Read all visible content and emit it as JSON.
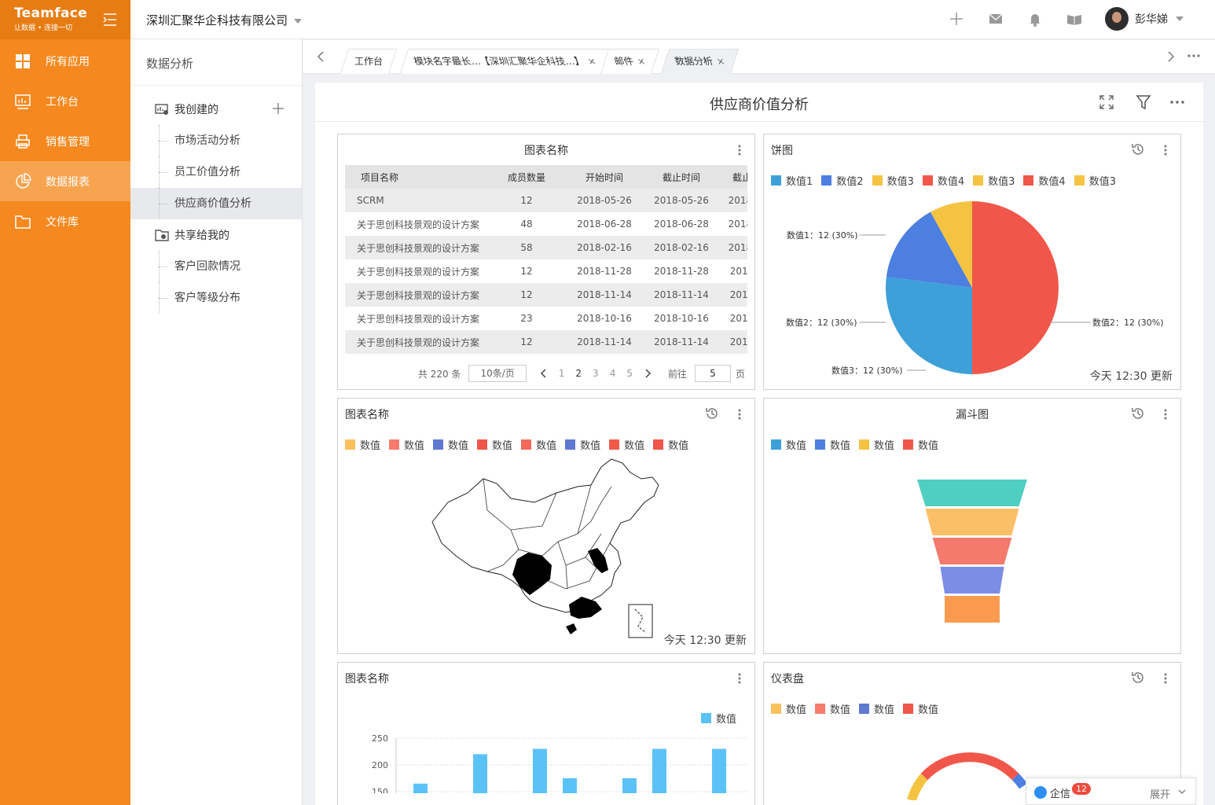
{
  "brand": {
    "name": "Teamface",
    "slogan": "让数据 • 连接一切"
  },
  "nav": [
    {
      "label": "所有应用",
      "icon": "grid-icon"
    },
    {
      "label": "工作台",
      "icon": "dashboard-icon"
    },
    {
      "label": "销售管理",
      "icon": "printer-icon"
    },
    {
      "label": "数据报表",
      "icon": "pie-chart-icon",
      "active": true
    },
    {
      "label": "文件库",
      "icon": "folder-icon"
    }
  ],
  "header": {
    "company": "深圳汇聚华企科技有限公司",
    "user": "彭华娣"
  },
  "tree": {
    "title": "数据分析",
    "mine": "我创建的",
    "mine_items": [
      "市场活动分析",
      "员工价值分析",
      "供应商价值分析"
    ],
    "shared": "共享给我的",
    "shared_items": [
      "客户回款情况",
      "客户等级分布"
    ]
  },
  "tabs": [
    "工作台",
    "模块名字最长…【深圳汇聚华企科技…】",
    "邮件",
    "数据分析"
  ],
  "page": {
    "title": "供应商价值分析"
  },
  "table_card": {
    "title": "图表名称",
    "columns": [
      "项目名称",
      "成员数量",
      "开始时间",
      "截止时间",
      "截止"
    ],
    "rows": [
      [
        "SCRM",
        "12",
        "2018-05-26",
        "2018-05-26",
        "2018-"
      ],
      [
        "关于思创科技景观的设计方案",
        "48",
        "2018-06-28",
        "2018-06-28",
        "2018-"
      ],
      [
        "关于思创科技景观的设计方案",
        "58",
        "2018-02-16",
        "2018-02-16",
        "2018-"
      ],
      [
        "关于思创科技景观的设计方案",
        "12",
        "2018-11-28",
        "2018-11-28",
        "2018"
      ],
      [
        "关于思创科技景观的设计方案",
        "12",
        "2018-11-14",
        "2018-11-14",
        "2018"
      ],
      [
        "关于思创科技景观的设计方案",
        "23",
        "2018-10-16",
        "2018-10-16",
        "2018"
      ],
      [
        "关于思创科技景观的设计方案",
        "12",
        "2018-11-14",
        "2018-11-14",
        "2018"
      ]
    ],
    "pager": {
      "total": "共 220 条",
      "size": "10条/页",
      "pages": [
        "1",
        "2",
        "3",
        "4",
        "5"
      ],
      "current": "2",
      "goto": "前往",
      "goto_value": "5",
      "page_unit": "页"
    }
  },
  "pie_card": {
    "title": "饼图",
    "legend": [
      {
        "name": "数值1",
        "color": "#3ea0d8"
      },
      {
        "name": "数值2",
        "color": "#4c7fe0"
      },
      {
        "name": "数值3",
        "color": "#f5c342"
      },
      {
        "name": "数值4",
        "color": "#f0574a"
      },
      {
        "name": "数值3",
        "color": "#f5c342"
      },
      {
        "name": "数值4",
        "color": "#f0574a"
      },
      {
        "name": "数值3",
        "color": "#f5c342"
      }
    ],
    "labels": [
      "数值1：12 (30%)",
      "数值2：12 (30%)",
      "数值3：12 (30%)",
      "数值2：12 (30%)"
    ],
    "updated": "今天 12:30 更新"
  },
  "map_card": {
    "title": "图表名称",
    "legend": [
      {
        "name": "数值",
        "color": "#f9c15d"
      },
      {
        "name": "数值",
        "color": "#f77b6c"
      },
      {
        "name": "数值",
        "color": "#5f78d0"
      },
      {
        "name": "数值",
        "color": "#ef5548"
      },
      {
        "name": "数值",
        "color": "#f26a5d"
      },
      {
        "name": "数值",
        "color": "#5f78d0"
      },
      {
        "name": "数值",
        "color": "#f15b4c"
      },
      {
        "name": "数值",
        "color": "#ef5548"
      }
    ],
    "updated": "今天 12:30 更新"
  },
  "funnel_card": {
    "title": "漏斗图",
    "legend": [
      {
        "name": "数值",
        "color": "#3ea0d8"
      },
      {
        "name": "数值",
        "color": "#4c7fe0"
      },
      {
        "name": "数值",
        "color": "#f5c342"
      },
      {
        "name": "数值",
        "color": "#f0574a"
      }
    ],
    "stages": [
      {
        "value": 100,
        "color": "#4ecfc1"
      },
      {
        "value": 85,
        "color": "#fbc067"
      },
      {
        "value": 72,
        "color": "#f37a6c"
      },
      {
        "value": 58,
        "color": "#7b8ee6"
      },
      {
        "value": 50,
        "color": "#fc9b4f"
      }
    ]
  },
  "bar_card": {
    "title": "图表名称",
    "legend": [
      {
        "name": "数值",
        "color": "#5bc2f7"
      }
    ]
  },
  "gauge_card": {
    "title": "仪表盘",
    "legend": [
      {
        "name": "数值",
        "color": "#f9c15d"
      },
      {
        "name": "数值",
        "color": "#f77b6c"
      },
      {
        "name": "数值",
        "color": "#5f78d0"
      },
      {
        "name": "数值",
        "color": "#ef5548"
      }
    ]
  },
  "chart_data": [
    {
      "type": "pie",
      "title": "饼图",
      "categories": [
        "数值4",
        "数值1",
        "数值2",
        "数值3"
      ],
      "values": [
        50,
        27,
        15,
        8
      ]
    },
    {
      "type": "bar",
      "series": [
        {
          "name": "数值",
          "values": [
            165,
            0,
            220,
            0,
            230,
            175,
            0,
            175,
            230,
            0,
            230
          ]
        }
      ],
      "ylim": [
        150,
        250
      ],
      "yticks": [
        250,
        200,
        150
      ]
    }
  ],
  "chat": {
    "label": "企信",
    "badge": "12",
    "expand": "展开"
  }
}
